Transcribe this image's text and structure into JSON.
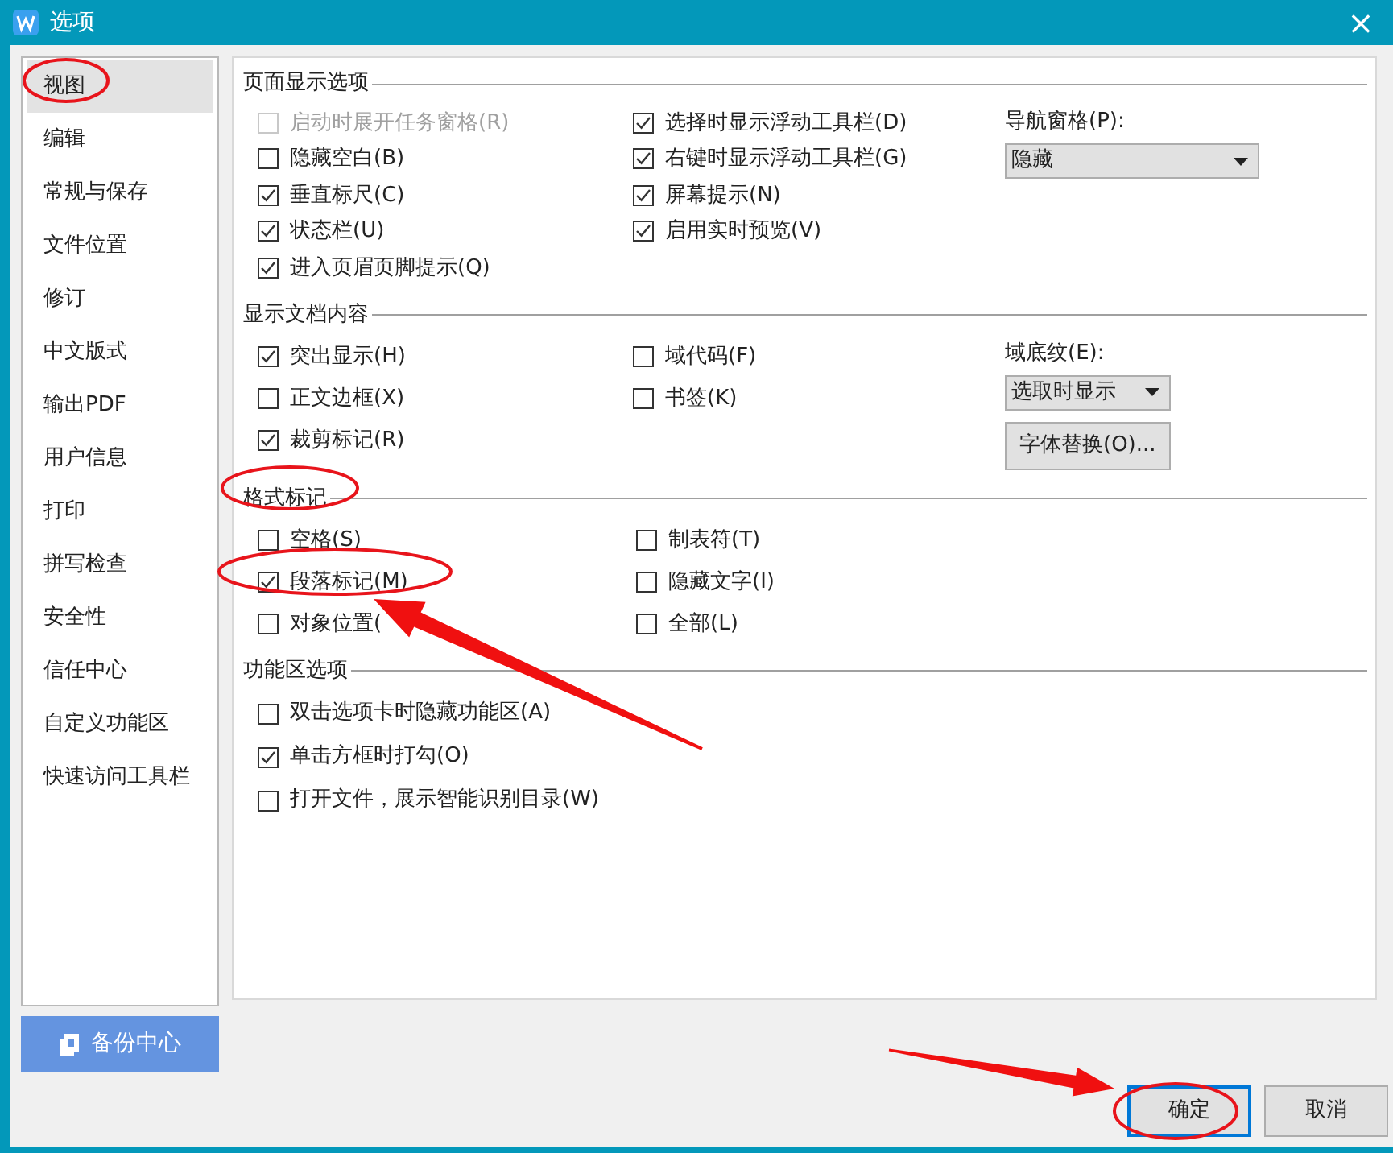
{
  "window": {
    "title": "选项",
    "close": "×"
  },
  "sidebar": {
    "items": [
      {
        "label": "视图",
        "selected": true
      },
      {
        "label": "编辑",
        "selected": false
      },
      {
        "label": "常规与保存",
        "selected": false
      },
      {
        "label": "文件位置",
        "selected": false
      },
      {
        "label": "修订",
        "selected": false
      },
      {
        "label": "中文版式",
        "selected": false
      },
      {
        "label": "输出PDF",
        "selected": false
      },
      {
        "label": "用户信息",
        "selected": false
      },
      {
        "label": "打印",
        "selected": false
      },
      {
        "label": "拼写检查",
        "selected": false
      },
      {
        "label": "安全性",
        "selected": false
      },
      {
        "label": "信任中心",
        "selected": false
      },
      {
        "label": "自定义功能区",
        "selected": false
      },
      {
        "label": "快速访问工具栏",
        "selected": false
      }
    ],
    "backup_button": "备份中心"
  },
  "sections": [
    {
      "title": "页面显示选项",
      "left": [
        {
          "label": "启动时展开任务窗格(R)",
          "checked": false,
          "disabled": true
        },
        {
          "label": "隐藏空白(B)",
          "checked": false,
          "disabled": false
        },
        {
          "label": "垂直标尺(C)",
          "checked": true,
          "disabled": false
        },
        {
          "label": "状态栏(U)",
          "checked": true,
          "disabled": false
        },
        {
          "label": "进入页眉页脚提示(Q)",
          "checked": true,
          "disabled": false
        }
      ],
      "right": [
        {
          "label": "选择时显示浮动工具栏(D)",
          "checked": true,
          "disabled": false
        },
        {
          "label": "右键时显示浮动工具栏(G)",
          "checked": true,
          "disabled": false
        },
        {
          "label": "屏幕提示(N)",
          "checked": true,
          "disabled": false
        },
        {
          "label": "启用实时预览(V)",
          "checked": true,
          "disabled": false
        }
      ],
      "controls": [
        {
          "kind": "label",
          "text": "导航窗格(P):"
        },
        {
          "kind": "select",
          "value": "隐藏"
        }
      ]
    },
    {
      "title": "显示文档内容",
      "left": [
        {
          "label": "突出显示(H)",
          "checked": true,
          "disabled": false
        },
        {
          "label": "正文边框(X)",
          "checked": false,
          "disabled": false
        },
        {
          "label": "裁剪标记(R)",
          "checked": true,
          "disabled": false
        }
      ],
      "right": [
        {
          "label": "域代码(F)",
          "checked": false,
          "disabled": false
        },
        {
          "label": "书签(K)",
          "checked": false,
          "disabled": false
        }
      ],
      "controls": [
        {
          "kind": "label",
          "text": "域底纹(E):"
        },
        {
          "kind": "select",
          "value": "选取时显示"
        },
        {
          "kind": "button",
          "text": "字体替换(O)..."
        }
      ]
    },
    {
      "title": "格式标记",
      "left": [
        {
          "label": "空格(S)",
          "checked": false,
          "disabled": false
        },
        {
          "label": "段落标记(M)",
          "checked": true,
          "disabled": false
        },
        {
          "label": "对象位置(",
          "checked": false,
          "disabled": false
        }
      ],
      "right": [
        {
          "label": "制表符(T)",
          "checked": false,
          "disabled": false
        },
        {
          "label": "隐藏文字(I)",
          "checked": false,
          "disabled": false
        },
        {
          "label": "全部(L)",
          "checked": false,
          "disabled": false
        }
      ]
    },
    {
      "title": "功能区选项",
      "left": [
        {
          "label": "双击选项卡时隐藏功能区(A)",
          "checked": false,
          "disabled": false
        },
        {
          "label": "单击方框时打勾(O)",
          "checked": true,
          "disabled": false
        },
        {
          "label": "打开文件，展示智能识别目录(W)",
          "checked": false,
          "disabled": false
        }
      ]
    }
  ],
  "footer": {
    "ok": "确定",
    "cancel": "取消"
  }
}
